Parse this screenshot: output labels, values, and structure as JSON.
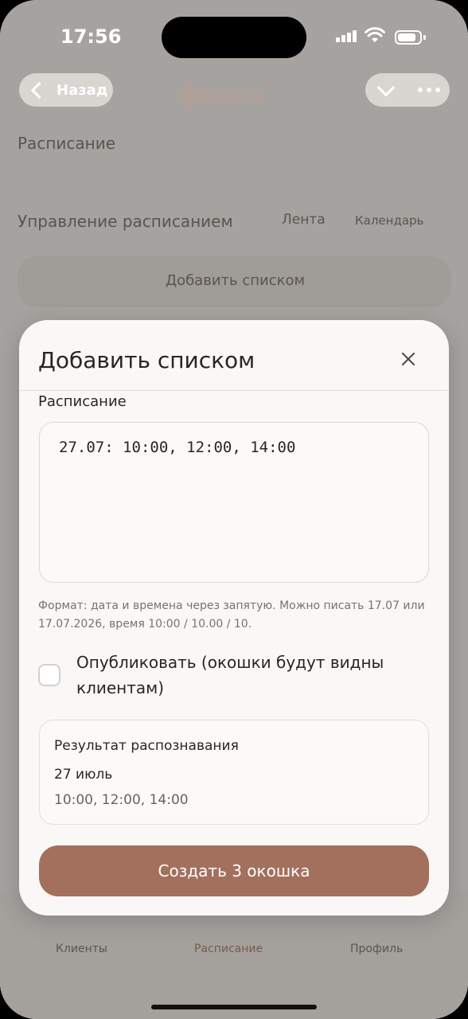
{
  "status_bar": {
    "time": "17:56"
  },
  "nav": {
    "back_label": "Назад",
    "logo": "фитсо"
  },
  "background": {
    "section_title": "Расписание",
    "manage_label": "Управление расписанием",
    "tab_tape": "Лента",
    "tab_calendar": "Календарь",
    "add_list_label": "Добавить списком",
    "tab_clients": "Клиенты",
    "tab_schedule": "Расписание",
    "tab_profile": "Профиль"
  },
  "modal": {
    "title": "Добавить списком",
    "schedule_label": "Расписание",
    "schedule_value": "27.07: 10:00, 12:00, 14:00",
    "hint": "Формат: дата и времена через запятую. Можно писать 17.07 или 17.07.2026, время 10:00 / 10.00 / 10.",
    "publish_label": "Опубликовать (окошки будут видны клиентам)",
    "publish_checked": false,
    "result": {
      "title": "Результат распознавания",
      "date": "27 июль",
      "times": "10:00, 12:00, 14:00"
    },
    "create_button": "Создать 3 окошка"
  },
  "colors": {
    "accent": "#a3705d",
    "modal_bg": "#f9f8f6",
    "text": "#2b2522"
  }
}
